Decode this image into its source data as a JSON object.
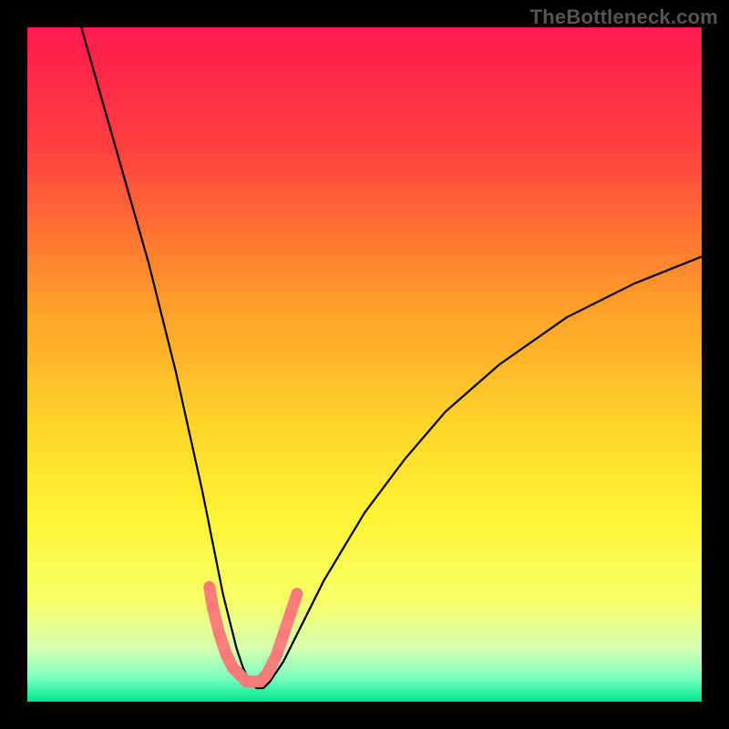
{
  "watermark": "TheBottleneck.com",
  "chart_data": {
    "type": "line",
    "title": "",
    "xlabel": "",
    "ylabel": "",
    "xlim": [
      0,
      100
    ],
    "ylim": [
      0,
      100
    ],
    "grid": false,
    "legend": false,
    "background_gradient_stops": [
      {
        "offset": 0.0,
        "color": "#ff1a4d"
      },
      {
        "offset": 0.18,
        "color": "#ff4040"
      },
      {
        "offset": 0.4,
        "color": "#ff9a2a"
      },
      {
        "offset": 0.58,
        "color": "#ffd22a"
      },
      {
        "offset": 0.72,
        "color": "#fff233"
      },
      {
        "offset": 0.85,
        "color": "#f6ff66"
      },
      {
        "offset": 0.92,
        "color": "#d8ffb0"
      },
      {
        "offset": 0.965,
        "color": "#7affc0"
      },
      {
        "offset": 1.0,
        "color": "#00e58a"
      }
    ],
    "series": [
      {
        "name": "bottleneck-curve",
        "color": "#000000",
        "width": 2.2,
        "x": [
          8,
          10,
          12,
          14,
          16,
          18,
          20,
          22,
          24,
          26,
          27,
          28,
          29,
          30,
          31,
          32,
          33,
          34,
          35,
          36,
          38,
          40,
          44,
          50,
          56,
          62,
          70,
          80,
          90,
          100
        ],
        "y": [
          100,
          93,
          86,
          79,
          72,
          65,
          57,
          49,
          40,
          31,
          26,
          21,
          16,
          12,
          8,
          5,
          3,
          2,
          2,
          3,
          6,
          10,
          18,
          28,
          36,
          43,
          50,
          57,
          62,
          66
        ]
      }
    ],
    "markers": {
      "name": "highlight-points",
      "color": "#f77a7a",
      "radius": 6,
      "points": [
        {
          "x": 27.0,
          "y": 17
        },
        {
          "x": 27.5,
          "y": 14
        },
        {
          "x": 28.5,
          "y": 10
        },
        {
          "x": 29.5,
          "y": 7
        },
        {
          "x": 30.5,
          "y": 5
        },
        {
          "x": 31.5,
          "y": 4
        },
        {
          "x": 32.5,
          "y": 3
        },
        {
          "x": 33.5,
          "y": 3
        },
        {
          "x": 34.5,
          "y": 3
        },
        {
          "x": 35.5,
          "y": 4
        },
        {
          "x": 37.0,
          "y": 7
        },
        {
          "x": 38.0,
          "y": 10
        },
        {
          "x": 39.0,
          "y": 13
        },
        {
          "x": 40.0,
          "y": 16
        }
      ]
    }
  }
}
